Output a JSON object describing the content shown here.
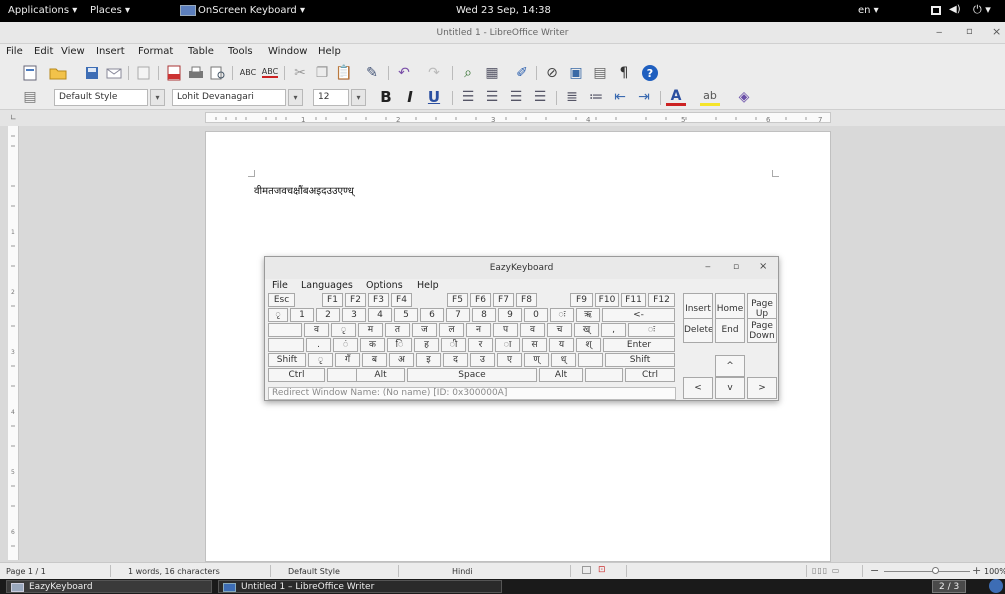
{
  "topbar": {
    "applications": "Applications ▾",
    "places": "Places ▾",
    "active_app": "OnScreen Keyboard ▾",
    "clock": "Wed 23 Sep, 14:38",
    "lang": "en ▾",
    "icons": [
      "window-icon",
      "volume-icon",
      "power-icon"
    ]
  },
  "window": {
    "title": "Untitled 1 - LibreOffice Writer",
    "minimize": "‒",
    "maximize": "▫",
    "close": "×"
  },
  "menu": [
    "File",
    "Edit",
    "View",
    "Insert",
    "Format",
    "Table",
    "Tools",
    "Window",
    "Help"
  ],
  "formatting": {
    "style": "Default Style",
    "font": "Lohit Devanagari",
    "size": "12",
    "bold": "B",
    "italic": "I",
    "underline": "U"
  },
  "document": {
    "text": "वीमतजवचक्षौंबअइदउउएण्ध्"
  },
  "status": {
    "page": "Page 1 / 1",
    "words": "1 words, 16 characters",
    "style": "Default Style",
    "language": "Hindi",
    "zoom": "100%"
  },
  "taskbar": {
    "task1": "EazyKeyboard",
    "task2": "Untitled 1 – LibreOffice Writer",
    "workspace": "2 / 3"
  },
  "keyboard": {
    "title": "EazyKeyboard",
    "menu": [
      "File",
      "Languages",
      "Options",
      "Help"
    ],
    "redirect_placeholder": "Redirect Window Name: (No name) [ID: 0x300000A]",
    "row_fn": [
      "Esc",
      "F1",
      "F2",
      "F3",
      "F4",
      "F5",
      "F6",
      "F7",
      "F8",
      "F9",
      "F10",
      "F11",
      "F12"
    ],
    "row1": [
      "ृ",
      "1",
      "2",
      "3",
      "4",
      "5",
      "6",
      "7",
      "8",
      "9",
      "0",
      "ः",
      "ऋ",
      "<-"
    ],
    "row2": [
      "व",
      "ृ",
      "म",
      "त",
      "ज",
      "ल",
      "न",
      "प",
      "व",
      "च",
      "ख्",
      "ः"
    ],
    "row3": [
      ".",
      "ं",
      "क",
      "ि",
      "ह",
      "ी",
      "र",
      "ा",
      "स",
      "य",
      "श्",
      "Enter"
    ],
    "row4": [
      "Shift",
      "ृ",
      "गँ",
      "ब",
      "अ",
      "इ",
      "द",
      "उ",
      "ए",
      "ण्",
      "ध्",
      "Shift"
    ],
    "row5": [
      "Ctrl",
      "Alt",
      "Space",
      "Alt",
      "Ctrl"
    ],
    "nav": {
      "insert": "Insert",
      "home": "Home",
      "pageup": "Page Up",
      "delete": "Delete",
      "end": "End",
      "pagedown": "Page Down",
      "up": "^",
      "left": "<",
      "down": "v",
      "right": ">"
    }
  },
  "colors": {
    "topbar": "#000000",
    "taskbar": "#1a1a1a",
    "help_icon": "#1f5fbf"
  }
}
